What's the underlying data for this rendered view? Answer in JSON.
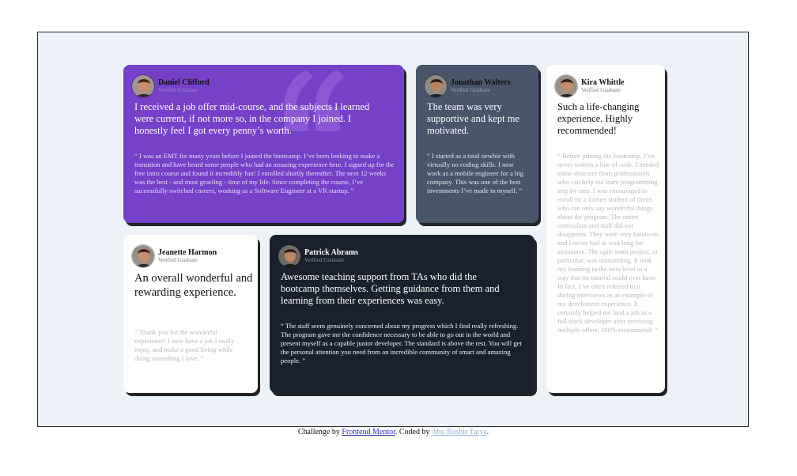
{
  "testimonials": {
    "daniel": {
      "name": "Daniel Clifford",
      "role": "Verified Graduate",
      "headline": "I received a job offer mid-course, and the subjects I learned were current, if not more so, in the company I joined. I honestly feel I got every penny’s worth.",
      "body": "“ I was an EMT for many years before I joined the bootcamp. I’ve been looking to make a transition and have heard some people who had an amazing experience here. I signed up for the free intro course and found it incredibly fun! I enrolled shortly thereafter. The next 12 weeks was the best - and most grueling - time of my life. Since completing the course, I’ve successfully switched careers, working as a Software Engineer at a VR startup. ”",
      "bg": "#7541c8"
    },
    "jonathan": {
      "name": "Jonathan Walters",
      "role": "Verified Graduate",
      "headline": "The team was very supportive and kept me motivated.",
      "body": "“ I started as a total newbie with virtually no coding skills. I now work as a mobile engineer for a big company. This was one of the best investments I’ve made in myself. ”",
      "bg": "#48556a"
    },
    "kira": {
      "name": "Kira Whittle",
      "role": "Verified Graduate",
      "headline": "Such a life-changing experience. Highly recommended!",
      "body": "“ Before joining the bootcamp, I’ve never written a line of code. I needed some structure from professionals who can help me learn programming step by step. I was encouraged to enroll by a former student of theirs who can only say wonderful things about the program. The entire curriculum and staff did not disappoint. They were very hands-on and I never had to wait long for assistance. The agile team project, in particular, was outstanding. It took my learning to the next level in a way that no tutorial could ever have. In fact, I’ve often referred to it during interviews as an example of my develoment experience. It certainly helped me land a job as a full-stack developer after receiving multiple offers. 100% recommend! ”",
      "bg": "#ffffff"
    },
    "jeanette": {
      "name": "Jeanette Harmon",
      "role": "Verified Graduate",
      "headline": "An overall wonderful and rewarding experience.",
      "body": "“ Thank you for the wonderful experience! I now have a job I really enjoy, and make a good living while doing something I love. ”",
      "bg": "#ffffff"
    },
    "patrick": {
      "name": "Patrick Abrams",
      "role": "Verified Graduate",
      "headline": "Awesome teaching support from TAs who did the bootcamp themselves. Getting guidance from them and learning from their experiences was easy.",
      "body": "“ The staff seem genuinely concerned about my progress which I find really refreshing. The program gave me the confidence necessary to be able to go out in the world and present myself as a capable junior developer. The standard is above the rest. You will get the personal attention you need from an incredible community of smart and amazing people. ”",
      "bg": "#19212e"
    }
  },
  "footer": {
    "prefix": "Challenge by ",
    "challenge_link": "Frontend Mentor",
    "middle": ". Coded by ",
    "author_link": "Abu Bashir Taiye",
    "suffix": "."
  },
  "colors": {
    "page_bg": "#ffffff",
    "frame_bg": "#edf2f8",
    "link": "#2b2cbd",
    "author_link": "#8fb3d8"
  },
  "icons": {
    "quote_mark": "quote-mark-icon",
    "avatar": "avatar-photo"
  }
}
